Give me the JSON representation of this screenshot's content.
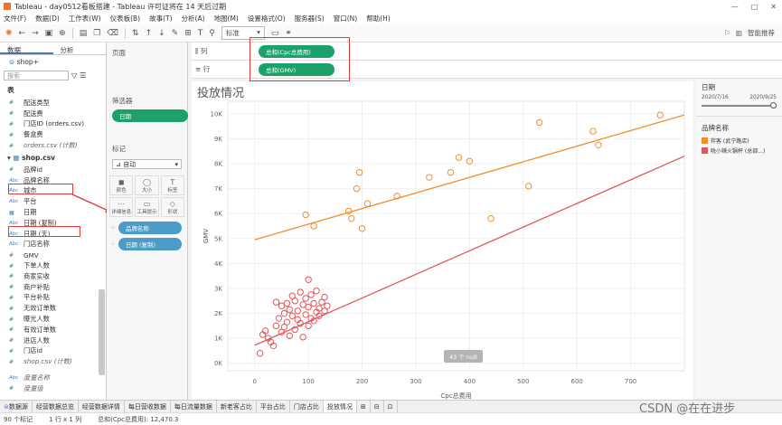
{
  "window": {
    "title": "Tableau - day0512看板搭建 - Tableau 许可证将在 14 天后过期",
    "controls": [
      "—",
      "□",
      "✕"
    ]
  },
  "menu": [
    "文件(F)",
    "数据(D)",
    "工作表(W)",
    "仪表板(B)",
    "故事(T)",
    "分析(A)",
    "地图(M)",
    "设置格式(O)",
    "服务器(S)",
    "窗口(N)",
    "帮助(H)"
  ],
  "toolbar": {
    "fit": "标准",
    "smart": "智能推荐"
  },
  "data_pane": {
    "tabs": [
      "数据",
      "分析"
    ],
    "datasource": "shop+",
    "search_placeholder": "搜索",
    "table_label": "表",
    "group1": [
      {
        "icon": "#",
        "label": "配送类型"
      },
      {
        "icon": "#",
        "label": "配送费"
      },
      {
        "icon": "#",
        "label": "门店ID (orders.csv)"
      },
      {
        "icon": "#",
        "label": "餐盒费"
      },
      {
        "icon": "#",
        "label": "orders.csv (计数)",
        "italic": true
      }
    ],
    "table2": "shop.csv",
    "group2": [
      {
        "icon": "#",
        "label": "品牌id"
      },
      {
        "icon": "Abc",
        "label": "品牌名称"
      },
      {
        "icon": "Abc",
        "label": "城市"
      },
      {
        "icon": "Abc",
        "label": "平台"
      },
      {
        "icon": "▦",
        "label": "日期"
      },
      {
        "icon": "Abc",
        "label": "日期 (复制)"
      },
      {
        "icon": "Abc",
        "label": "日期 (天)"
      },
      {
        "icon": "Abc",
        "label": "门店名称"
      },
      {
        "icon": "#",
        "label": "GMV"
      },
      {
        "icon": "#",
        "label": "下单人数"
      },
      {
        "icon": "#",
        "label": "商家实收"
      },
      {
        "icon": "#",
        "label": "商户补贴"
      },
      {
        "icon": "#",
        "label": "平台补贴"
      },
      {
        "icon": "#",
        "label": "无效订单数"
      },
      {
        "icon": "#",
        "label": "曝光人数"
      },
      {
        "icon": "#",
        "label": "有效订单数"
      },
      {
        "icon": "#",
        "label": "进店人数"
      },
      {
        "icon": "#",
        "label": "门店id"
      },
      {
        "icon": "#",
        "label": "shop.csv (计数)",
        "italic": true
      }
    ],
    "footer_items": [
      "度量名称",
      "度量值"
    ]
  },
  "mid_pane": {
    "pages": "页面",
    "filters": "筛选器",
    "filter_pill": "日期",
    "marks": "标记",
    "mark_type": "自动",
    "mark_buttons": [
      {
        "glyph": "◼",
        "label": "颜色"
      },
      {
        "glyph": "◯",
        "label": "大小"
      },
      {
        "glyph": "T",
        "label": "标签"
      },
      {
        "glyph": "⋯",
        "label": "详细信息"
      },
      {
        "glyph": "▭",
        "label": "工具提示"
      },
      {
        "glyph": "◇",
        "label": "形状"
      }
    ],
    "mark_pills": [
      "品牌名称",
      "日期 (复制)"
    ]
  },
  "shelves": {
    "columns_label": "列",
    "columns_pill": "总和(Cpc总费用)",
    "rows_label": "行",
    "rows_pill": "总和(GMV)"
  },
  "view": {
    "title": "投放情况",
    "null_badge": "43 个 null"
  },
  "right_pane": {
    "date_title": "日期",
    "date_from": "2020/7/16",
    "date_to": "2020/9/25",
    "legend_title": "品牌名称",
    "legend": [
      {
        "label": "拌客 (武宁路店)",
        "color": "#f28e2b"
      },
      {
        "label": "吮小辣火锅杯 (总部...)",
        "color": "#e15759"
      }
    ]
  },
  "sheet_tabs": [
    "数据源",
    "经营数据总览",
    "经营数据详情",
    "每日营收数据",
    "每日流量数据",
    "新老客占比",
    "平台占比",
    "门店占比",
    "投放情况"
  ],
  "status": {
    "marks": "90 个标记",
    "rows": "1 行 x 1 列",
    "sum": "总和(Cpc总费用): 12,470.3"
  },
  "watermark": "CSDN @在在进步",
  "chart_data": {
    "type": "scatter",
    "title": "投放情况",
    "xlabel": "Cpc总费用",
    "ylabel": "GMV",
    "xlim": [
      -50,
      800
    ],
    "ylim": [
      -300,
      10500
    ],
    "x_ticks": [
      0,
      100,
      200,
      300,
      400,
      500,
      600,
      700
    ],
    "y_ticks": [
      0,
      1000,
      2000,
      3000,
      4000,
      5000,
      6000,
      7000,
      8000,
      9000,
      10000
    ],
    "y_tick_labels": [
      "0K",
      "1K",
      "2K",
      "3K",
      "4K",
      "5K",
      "6K",
      "7K",
      "8K",
      "9K",
      "10K"
    ],
    "grid": true,
    "legend_position": "right",
    "series": [
      {
        "name": "拌客 (武宁路店)",
        "color": "#f28e2b",
        "trend": [
          [
            0,
            4950
          ],
          [
            800,
            9950
          ]
        ],
        "points": [
          [
            95,
            5950
          ],
          [
            110,
            5500
          ],
          [
            175,
            6100
          ],
          [
            180,
            5800
          ],
          [
            190,
            7000
          ],
          [
            195,
            7650
          ],
          [
            200,
            5400
          ],
          [
            210,
            6400
          ],
          [
            265,
            6700
          ],
          [
            325,
            7450
          ],
          [
            365,
            7650
          ],
          [
            380,
            8250
          ],
          [
            400,
            8100
          ],
          [
            440,
            5800
          ],
          [
            510,
            7100
          ],
          [
            530,
            9650
          ],
          [
            630,
            9300
          ],
          [
            640,
            8750
          ],
          [
            755,
            9950
          ]
        ]
      },
      {
        "name": "吮小辣火锅杯 (总部...)",
        "color": "#e15759",
        "trend": [
          [
            0,
            720
          ],
          [
            800,
            8300
          ]
        ],
        "points": [
          [
            10,
            400
          ],
          [
            15,
            1150
          ],
          [
            20,
            1300
          ],
          [
            25,
            1000
          ],
          [
            30,
            850
          ],
          [
            35,
            700
          ],
          [
            40,
            1500
          ],
          [
            40,
            2450
          ],
          [
            45,
            1800
          ],
          [
            50,
            2300
          ],
          [
            50,
            1250
          ],
          [
            55,
            2000
          ],
          [
            55,
            1450
          ],
          [
            60,
            2400
          ],
          [
            60,
            1650
          ],
          [
            65,
            2150
          ],
          [
            65,
            1100
          ],
          [
            70,
            2700
          ],
          [
            70,
            1900
          ],
          [
            75,
            1350
          ],
          [
            75,
            2500
          ],
          [
            80,
            1750
          ],
          [
            80,
            2100
          ],
          [
            85,
            2850
          ],
          [
            85,
            1600
          ],
          [
            90,
            2350
          ],
          [
            90,
            1050
          ],
          [
            95,
            1950
          ],
          [
            95,
            2600
          ],
          [
            100,
            3350
          ],
          [
            100,
            2250
          ],
          [
            100,
            1500
          ],
          [
            105,
            1800
          ],
          [
            105,
            2750
          ],
          [
            110,
            2400
          ],
          [
            110,
            1700
          ],
          [
            115,
            2050
          ],
          [
            115,
            2900
          ],
          [
            120,
            2200
          ],
          [
            120,
            1900
          ],
          [
            125,
            2450
          ],
          [
            130,
            2100
          ],
          [
            130,
            2650
          ],
          [
            135,
            2300
          ]
        ]
      }
    ]
  }
}
